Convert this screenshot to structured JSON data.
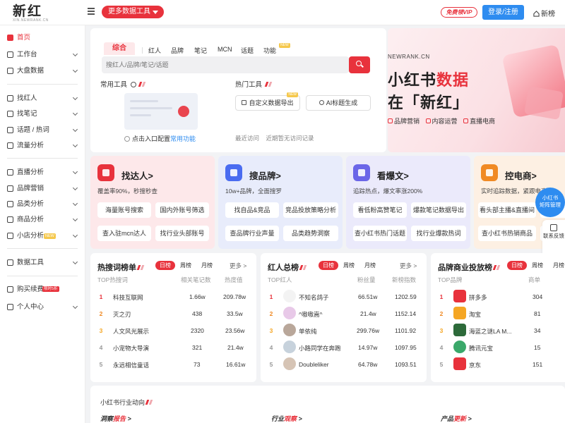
{
  "header": {
    "logo_text": "新红",
    "logo_sub": "XIN.NEWRANK.CN",
    "more_tools_label": "更多数据工具",
    "vip_label": "免费领VIP",
    "login_label": "登录/注册",
    "new_list_label": "新榜"
  },
  "sidebar": {
    "items": [
      {
        "label": "首页",
        "icon": "home-icon"
      },
      {
        "label": "工作台",
        "icon": "workbench-icon"
      },
      {
        "label": "大盘数据",
        "icon": "dashboard-icon"
      },
      {
        "label": "找红人",
        "icon": "search-person-icon"
      },
      {
        "label": "找笔记",
        "icon": "note-icon"
      },
      {
        "label": "话题 / 热词",
        "icon": "topic-icon"
      },
      {
        "label": "流量分析",
        "icon": "traffic-icon"
      },
      {
        "label": "直播分析",
        "icon": "live-icon"
      },
      {
        "label": "品牌营销",
        "icon": "brand-icon"
      },
      {
        "label": "品类分析",
        "icon": "category-icon"
      },
      {
        "label": "商品分析",
        "icon": "product-icon"
      },
      {
        "label": "小店分析",
        "icon": "shop-icon"
      },
      {
        "label": "数据工具",
        "icon": "tools-icon"
      },
      {
        "label": "购买续费",
        "icon": "purchase-icon"
      },
      {
        "label": "个人中心",
        "icon": "user-icon"
      }
    ],
    "new_badge": "NEW",
    "promo_badge": "限时5折"
  },
  "search": {
    "tabs": [
      "综合",
      "红人",
      "品牌",
      "笔记",
      "MCN",
      "话题",
      "功能"
    ],
    "new_badge": "NEW",
    "placeholder": "搜红人/品牌/笔记/话题",
    "common_tools_title": "常用工具",
    "config_prefix": "点击入口配置",
    "config_link": "常用功能",
    "hot_tools_title": "热门工具",
    "hot_tools": [
      "自定义数据导出",
      "AI标题生成"
    ],
    "hot_new_badge": "NEW",
    "recent_label": "最近访问",
    "recent_empty": "近期暂无访问记录"
  },
  "banner": {
    "site": "NEWRANK.CN",
    "line1_prefix": "小红书",
    "line1_highlight": "数据",
    "line2": "在「新红」",
    "tags": [
      "品牌营销",
      "内容运营",
      "直播电商"
    ]
  },
  "features": [
    {
      "title": "找达人>",
      "desc": "覆盖率90%，秒搜秒查",
      "color": "#e8323c",
      "bg": "#fde8ea",
      "buttons": [
        "海量账号搜索",
        "国内外账号筛选",
        "查入驻mcn达人",
        "找行业头部账号"
      ]
    },
    {
      "title": "搜品牌>",
      "desc": "10w+品牌，全面搜罗",
      "color": "#4a6cf0",
      "bg": "#e8ecfb",
      "buttons": [
        "找自品&竞品",
        "竞品投放策略分析",
        "查品牌行业声量",
        "品类趋势洞察"
      ]
    },
    {
      "title": "看爆文>",
      "desc": "追踪热点，爆文率涨200%",
      "color": "#6b66e8",
      "bg": "#ebeafb",
      "buttons": [
        "看低粉高赞笔记",
        "爆款笔记数据导出",
        "查小红书热门话题",
        "找行业爆款热词"
      ]
    },
    {
      "title": "控电商>",
      "desc": "实时追踪数据，紧跟电商",
      "color": "#f08a24",
      "bg": "#fdf0e3",
      "buttons": [
        "看头部主播&直播间",
        "追",
        "查小红书热销商品",
        "找"
      ]
    }
  ],
  "float": {
    "badge_line1": "小红书",
    "badge_line2": "矩阵管理",
    "items": [
      "联系反馈",
      "报告",
      "新手"
    ]
  },
  "rank_hot": {
    "title": "热搜词榜单",
    "tabs": [
      "日榜",
      "周榜",
      "月榜"
    ],
    "more": "更多",
    "headers": [
      "TOP热搜词",
      "相关笔记数",
      "热度值"
    ],
    "rows": [
      {
        "rank": "1",
        "name": "科技互联网",
        "a": "1.66w",
        "b": "209.78w"
      },
      {
        "rank": "2",
        "name": "灭之刃",
        "a": "438",
        "b": "33.5w"
      },
      {
        "rank": "3",
        "name": "人文风光展示",
        "a": "2320",
        "b": "23.56w"
      },
      {
        "rank": "4",
        "name": "小宠物大导演",
        "a": "321",
        "b": "21.4w"
      },
      {
        "rank": "5",
        "name": "永远相信童话",
        "a": "73",
        "b": "16.61w"
      }
    ]
  },
  "rank_red": {
    "title": "红人总榜",
    "tabs": [
      "日榜",
      "周榜",
      "月榜"
    ],
    "more": "更多",
    "headers": [
      "TOP红人",
      "粉丝量",
      "新榜指数"
    ],
    "rows": [
      {
        "rank": "1",
        "name": "不知名鸽子",
        "a": "66.51w",
        "b": "1202.59"
      },
      {
        "rank": "2",
        "name": "^嗷嗷嵩^",
        "a": "21.4w",
        "b": "1152.14"
      },
      {
        "rank": "3",
        "name": "单依纯",
        "a": "299.76w",
        "b": "1101.92"
      },
      {
        "rank": "4",
        "name": "小路同学在奔跑",
        "a": "14.97w",
        "b": "1097.95"
      },
      {
        "rank": "5",
        "name": "Doubleliker",
        "a": "64.78w",
        "b": "1093.51"
      }
    ]
  },
  "rank_brand": {
    "title": "品牌商业投放榜",
    "tabs": [
      "日榜",
      "周榜",
      "月榜"
    ],
    "headers": [
      "TOP品牌",
      "商单"
    ],
    "rows": [
      {
        "rank": "1",
        "name": "拼多多",
        "a": "304",
        "color": "#e8323c"
      },
      {
        "rank": "2",
        "name": "淘宝",
        "a": "81",
        "color": "#f5a623"
      },
      {
        "rank": "3",
        "name": "海蓝之谜LA M...",
        "a": "34",
        "color": "#2d6a3a"
      },
      {
        "rank": "4",
        "name": "腾讯元宝",
        "a": "15",
        "color": "#3aa86a"
      },
      {
        "rank": "5",
        "name": "京东",
        "a": "151",
        "color": "#e8323c"
      }
    ]
  },
  "bottom": {
    "title": "小红书行业动向",
    "links": [
      {
        "prefix": "洞察",
        "highlight": "报告",
        "suffix": " >"
      },
      {
        "prefix": "行业",
        "highlight": "观察",
        "suffix": " >"
      },
      {
        "prefix": "产品",
        "highlight": "更新",
        "suffix": " >"
      }
    ]
  }
}
